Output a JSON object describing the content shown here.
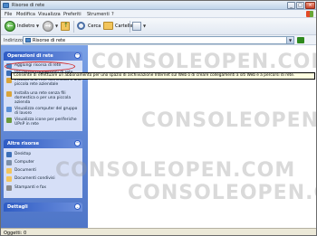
{
  "window": {
    "title": "Risorse di rete",
    "controls": [
      "_",
      "□",
      "×"
    ]
  },
  "menu": [
    "File",
    "Modifica",
    "Visualizza",
    "Preferiti",
    "Strumenti",
    "?"
  ],
  "toolbar": {
    "back_label": "Indietro",
    "search_label": "Cerca",
    "folders_label": "Cartelle"
  },
  "address": {
    "label": "Indirizzo",
    "value": "Risorse di rete"
  },
  "taskpane": {
    "network_tasks": {
      "title": "Operazioni di rete",
      "items": [
        {
          "label": "Aggiungi risorsa di rete",
          "icon": "add-network-place-icon"
        },
        {
          "label": "Visualizza connessioni di rete",
          "icon": "network-connections-icon"
        },
        {
          "label": "Installa una rete domestica o una piccola rete aziendale",
          "icon": "home-network-icon"
        },
        {
          "label": "Installa una rete senza fili domestica o per una piccola azienda",
          "icon": "wireless-network-icon"
        },
        {
          "label": "Visualizza computer del gruppo di lavoro",
          "icon": "workgroup-computers-icon"
        },
        {
          "label": "Visualizza icone per periferiche UPnP in rete",
          "icon": "upnp-icon"
        }
      ]
    },
    "other_places": {
      "title": "Altre risorse",
      "items": [
        {
          "label": "Desktop",
          "icon": "desktop-icon"
        },
        {
          "label": "Computer",
          "icon": "computer-icon"
        },
        {
          "label": "Documenti",
          "icon": "documents-icon"
        },
        {
          "label": "Documenti condivisi",
          "icon": "shared-documents-icon"
        },
        {
          "label": "Stampanti e fax",
          "icon": "printers-icon"
        }
      ]
    },
    "details": {
      "title": "Dettagli"
    }
  },
  "tooltip": "Consente di effettuare un abbonamento per uno spazio di archiviazione Internet sul Web o di creare collegamenti a siti Web e a percorsi di rete.",
  "watermark": "CONSOLEOPEN.COM",
  "status": {
    "text": "Oggetti: 0"
  },
  "colors": {
    "taskpane_top": "#7aa1e6",
    "panel_header": "#2f5cc4",
    "panel_body": "#d6dff7",
    "highlight_ring": "#d21f1f",
    "tooltip_bg": "#ffffe1"
  }
}
